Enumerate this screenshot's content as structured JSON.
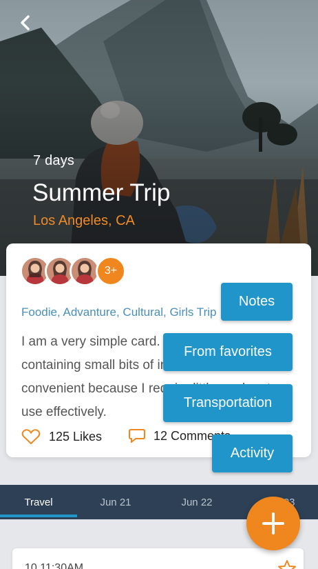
{
  "hero": {
    "days": "7 days",
    "title": "Summer Trip",
    "location": "Los Angeles, CA",
    "back_icon": "chevron-left-icon"
  },
  "card": {
    "avatars_more": "3+",
    "tags": "Foodie, Advanture, Cultural, Girls Trip",
    "description": "I am a very simple card. I am good at containing small bits of information. I am convenient because I require little markup to use effectively.",
    "likes": "125 Likes",
    "comments": "12 Comments"
  },
  "menu": {
    "notes": "Notes",
    "favorites": "From favorites",
    "transportation": "Transportation",
    "activity": "Activity"
  },
  "tabs": [
    {
      "label": "Travel",
      "active": true
    },
    {
      "label": "Jun 21",
      "active": false
    },
    {
      "label": "Jun 22",
      "active": false
    },
    {
      "label": "Jun 23",
      "active": false
    }
  ],
  "itinerary": {
    "time": "10 11:30AM"
  },
  "colors": {
    "accent": "#f0861e",
    "primary": "#1f95c9",
    "tabbar": "#2d4055"
  }
}
